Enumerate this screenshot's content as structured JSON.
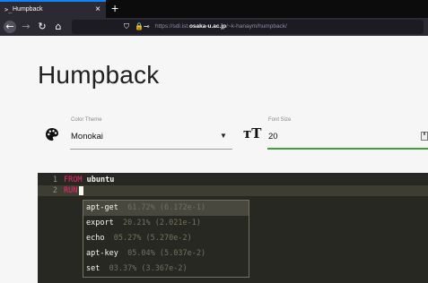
{
  "browser": {
    "tab": {
      "icon": ">_",
      "title": "Humpback",
      "close": "×"
    },
    "newtab": "+",
    "nav": {
      "back": "←",
      "forward": "→",
      "reload": "↻",
      "home": "⌂"
    },
    "url": {
      "shield": "⛉",
      "lock": "🔒⊸",
      "prefix": "https://sdl.ist.",
      "domain": "osaka-u.ac.jp",
      "suffix": "/~k-hanaym/humpback/"
    }
  },
  "page": {
    "title": "Humpback",
    "color_theme": {
      "icon": "palette-icon",
      "label": "Color Theme",
      "value": "Monokai",
      "arrow": "▼"
    },
    "font_size": {
      "icon": "text-size-icon",
      "glyph": "тT",
      "label": "Font Size",
      "value": "20",
      "stepper": "⬍"
    }
  },
  "editor": {
    "theme": "Monokai",
    "colors": {
      "background": "#272822",
      "keyword": "#f92672",
      "text": "#f8f8f2",
      "comment": "#75715e"
    },
    "lines": [
      {
        "num": "1",
        "keyword": "FROM",
        "rest": " ubuntu"
      },
      {
        "num": "2",
        "keyword": "RUN",
        "rest": ""
      }
    ]
  },
  "autocomplete": {
    "items": [
      {
        "word": "apt-get",
        "score": "61.72% (6.172e-1)",
        "selected": true
      },
      {
        "word": "export",
        "score": "20.21% (2.021e-1)",
        "selected": false
      },
      {
        "word": "echo",
        "score": "05.27% (5.270e-2)",
        "selected": false
      },
      {
        "word": "apt-key",
        "score": "05.04% (5.037e-2)",
        "selected": false
      },
      {
        "word": "set",
        "score": "03.37% (3.367e-2)",
        "selected": false
      }
    ]
  }
}
